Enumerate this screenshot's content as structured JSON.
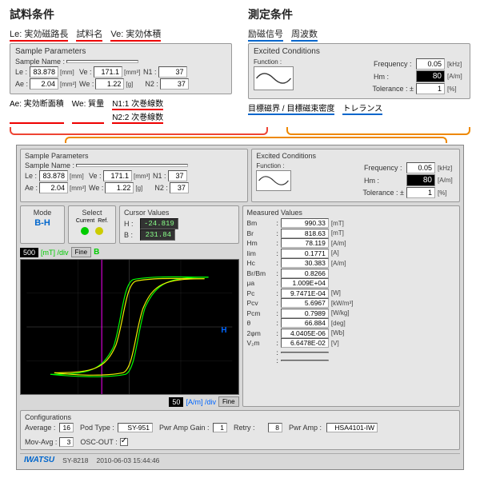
{
  "callouts": {
    "sample": {
      "title": "試料条件",
      "le_label": "Le: 実効磁路長",
      "name_label": "試料名",
      "ve_label": "Ve: 実効体積",
      "ae_label": "Ae: 実効断面積",
      "we_label": "We: 質量",
      "n1_label": "N1:1 次巻線数",
      "n2_label": "N2:2 次巻線数"
    },
    "excited": {
      "title": "測定条件",
      "signal_label": "励磁信号",
      "freq_label": "周波数",
      "target_label": "目標磁界 / 目標磁束密度",
      "tolerance_label": "トレランス"
    }
  },
  "sample": {
    "panel_title": "Sample Parameters",
    "name_label": "Sample Name :",
    "name_value": "",
    "le": {
      "label": "Le :",
      "value": "83.878",
      "unit": "[mm]"
    },
    "ve": {
      "label": "Ve :",
      "value": "171.1",
      "unit": "[mm³]"
    },
    "n1": {
      "label": "N1 :",
      "value": "37"
    },
    "ae": {
      "label": "Ae :",
      "value": "2.04",
      "unit": "[mm²]"
    },
    "we": {
      "label": "We :",
      "value": "1.22",
      "unit": "[g]"
    },
    "n2": {
      "label": "N2 :",
      "value": "37"
    }
  },
  "excited": {
    "panel_title": "Excited Conditions",
    "function_label": "Function :",
    "freq": {
      "label": "Frequency :",
      "value": "0.05",
      "unit": "[kHz]"
    },
    "hm": {
      "label": "Hm :",
      "value": "80",
      "unit": "[A/m]"
    },
    "tol": {
      "label": "Tolerance : ±",
      "value": "1",
      "unit": "[%]"
    }
  },
  "mode": {
    "title": "Mode",
    "value": "B-H"
  },
  "select": {
    "title": "Select",
    "current": "Current",
    "ref": "Ref."
  },
  "cursor": {
    "title": "Cursor Values",
    "h": {
      "label": "H :",
      "value": "-24.819"
    },
    "b": {
      "label": "B :",
      "value": "231.84"
    }
  },
  "graph": {
    "y_scale": "500",
    "y_unit": "[mT] /div",
    "fine_btn": "Fine",
    "b_label": "B",
    "h_label": "H",
    "x_scale": "50",
    "x_unit": "[A/m] /div"
  },
  "measured": {
    "title": "Measured Values",
    "rows": [
      {
        "label": "Bm",
        "value": "990.33",
        "unit": "[mT]"
      },
      {
        "label": "Br",
        "value": "818.63",
        "unit": "[mT]"
      },
      {
        "label": "Hm",
        "value": "78.119",
        "unit": "[A/m]"
      },
      {
        "label": "Iim",
        "value": "0.1771",
        "unit": "[A]"
      },
      {
        "label": "Hc",
        "value": "30.383",
        "unit": "[A/m]"
      },
      {
        "label": "Br/Bm",
        "value": "0.8266",
        "unit": ""
      },
      {
        "label": "μa",
        "value": "1.009E+04",
        "unit": ""
      },
      {
        "label": "Pc",
        "value": "9.7471E-04",
        "unit": "[W]"
      },
      {
        "label": "Pcv",
        "value": "5.6967",
        "unit": "[kW/m³]"
      },
      {
        "label": "Pcm",
        "value": "0.7989",
        "unit": "[W/kg]"
      },
      {
        "label": "θ",
        "value": "66.884",
        "unit": "[deg]"
      },
      {
        "label": "2φm",
        "value": "4.0405E-06",
        "unit": "[Wb]"
      },
      {
        "label": "V₂m",
        "value": "6.6478E-02",
        "unit": "[V]"
      },
      {
        "label": "",
        "value": "",
        "unit": ""
      },
      {
        "label": "",
        "value": "",
        "unit": ""
      }
    ]
  },
  "config": {
    "title": "Configurations",
    "average": {
      "label": "Average :",
      "value": "16"
    },
    "pod_type": {
      "label": "Pod Type :",
      "value": "SY-951"
    },
    "pwr_gain": {
      "label": "Pwr Amp Gain :",
      "value": "1"
    },
    "retry": {
      "label": "Retry :",
      "value": "8"
    },
    "pwr_amp": {
      "label": "Pwr Amp :",
      "value": "HSA4101-IW"
    },
    "mov_avg": {
      "label": "Mov-Avg :",
      "value": "3"
    },
    "osc_out": {
      "label": "OSC-OUT :"
    }
  },
  "status": {
    "logo": "IWATSU",
    "model": "SY-8218",
    "timestamp": "2010-06-03 15:44:46"
  }
}
